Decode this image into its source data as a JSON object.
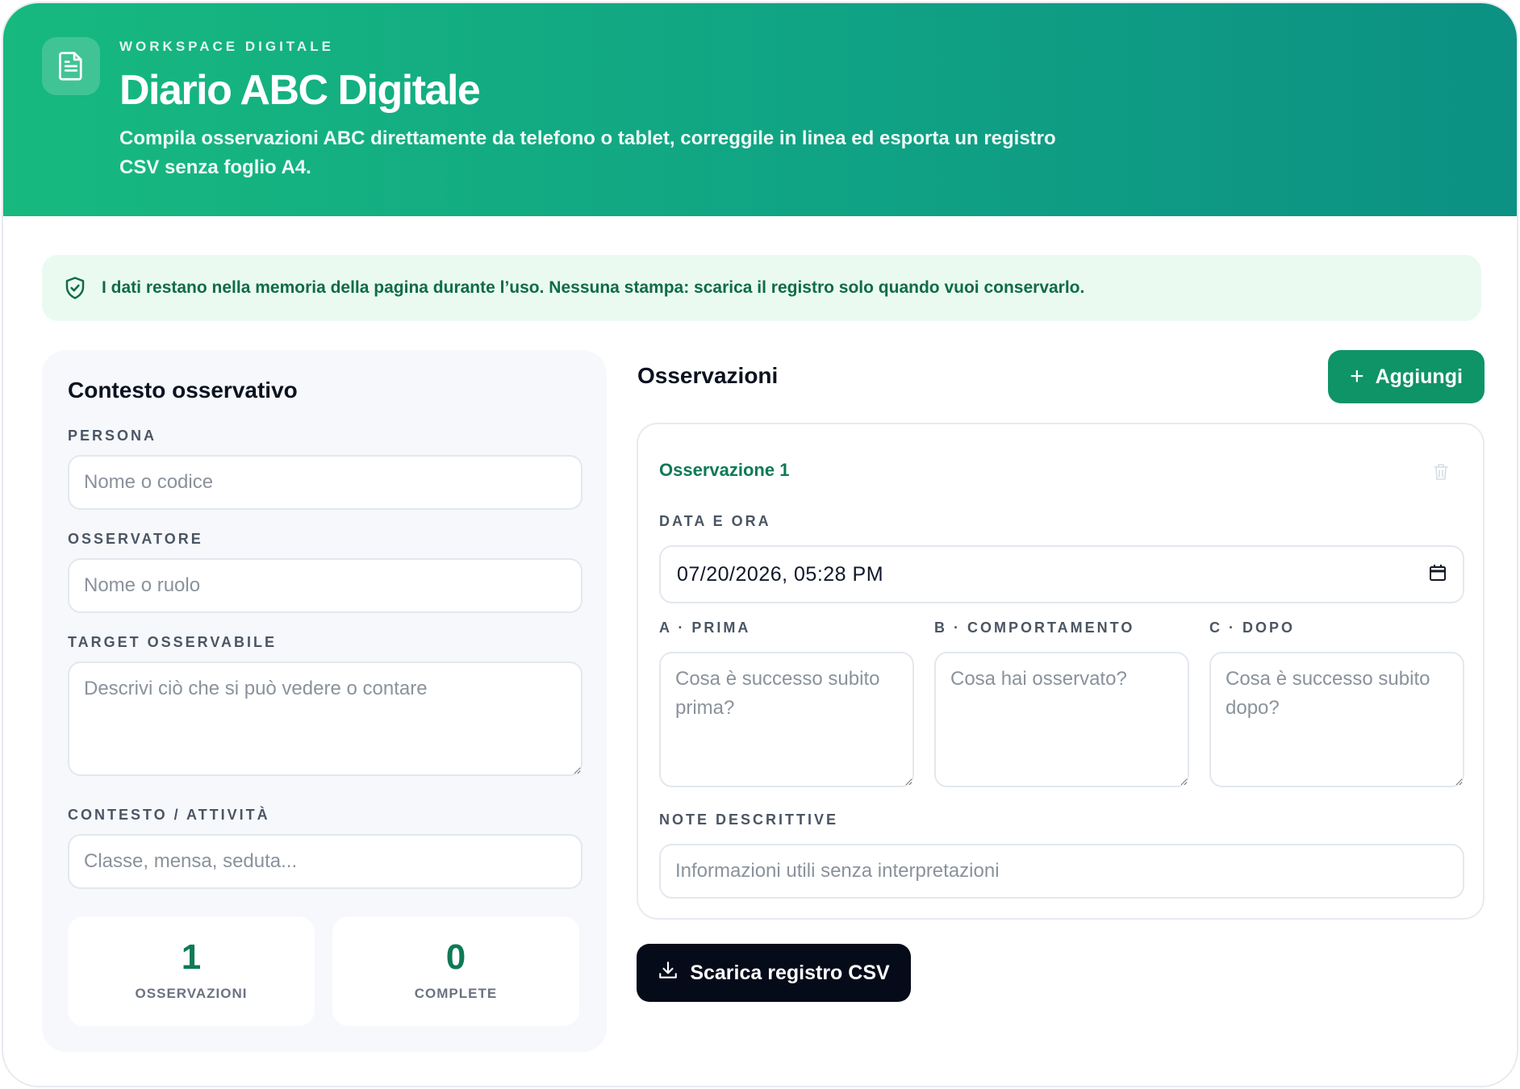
{
  "header": {
    "eyebrow": "WORKSPACE DIGITALE",
    "title": "Diario ABC Digitale",
    "subtitle": "Compila osservazioni ABC direttamente da telefono o tablet, correggile in linea ed esporta un registro CSV senza foglio A4.",
    "icon": "document-icon"
  },
  "notice": {
    "icon": "shield-check-icon",
    "text": "I dati restano nella memoria della pagina durante l’uso. Nessuna stampa: scarica il registro solo quando vuoi conservarlo."
  },
  "context": {
    "title": "Contesto osservativo",
    "persona": {
      "label": "PERSONA",
      "placeholder": "Nome o codice",
      "value": ""
    },
    "osservatore": {
      "label": "OSSERVATORE",
      "placeholder": "Nome o ruolo",
      "value": ""
    },
    "target": {
      "label": "TARGET OSSERVABILE",
      "placeholder": "Descrivi ciò che si può vedere o contare",
      "value": ""
    },
    "contesto": {
      "label": "CONTESTO / ATTIVITÀ",
      "placeholder": "Classe, mensa, seduta...",
      "value": ""
    }
  },
  "stats": [
    {
      "value": "1",
      "label": "OSSERVAZIONI"
    },
    {
      "value": "0",
      "label": "COMPLETE"
    }
  ],
  "observations": {
    "heading": "Osservazioni",
    "add_label": "Aggiungi",
    "items": [
      {
        "title": "Osservazione 1",
        "datetime_label": "DATA E ORA",
        "datetime_value": "07/20/2026, 05:28 PM",
        "a_label": "A · PRIMA",
        "a_placeholder": "Cosa è successo subito prima?",
        "b_label": "B · COMPORTAMENTO",
        "b_placeholder": "Cosa hai osservato?",
        "c_label": "C · DOPO",
        "c_placeholder": "Cosa è successo subito dopo?",
        "notes_label": "NOTE DESCRITTIVE",
        "notes_placeholder": "Informazioni utili senza interpretazioni"
      }
    ]
  },
  "download_label": "Scarica registro CSV",
  "colors": {
    "header_start": "#17b97f",
    "header_end": "#0c9183",
    "accent_green": "#0e9466",
    "text_green": "#0e7a55",
    "notice_bg": "#eafaf1",
    "dark_button": "#060b1a"
  }
}
